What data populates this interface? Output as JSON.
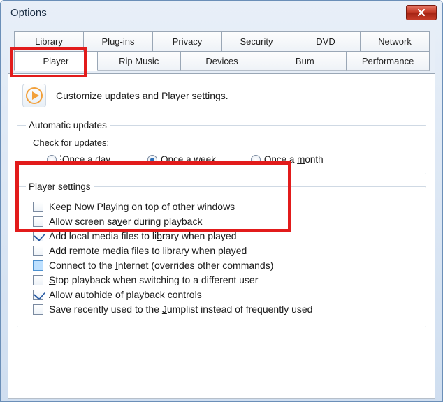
{
  "window": {
    "title": "Options"
  },
  "tabs": {
    "row1": [
      {
        "label": "Library",
        "name": "tab-library"
      },
      {
        "label": "Plug-ins",
        "name": "tab-plugins"
      },
      {
        "label": "Privacy",
        "name": "tab-privacy"
      },
      {
        "label": "Security",
        "name": "tab-security"
      },
      {
        "label": "DVD",
        "name": "tab-dvd"
      },
      {
        "label": "Network",
        "name": "tab-network"
      }
    ],
    "row2": [
      {
        "label": "Player",
        "name": "tab-player",
        "active": true
      },
      {
        "label": "Rip Music",
        "name": "tab-rip-music"
      },
      {
        "label": "Devices",
        "name": "tab-devices"
      },
      {
        "label": "Bum",
        "name": "tab-burn"
      },
      {
        "label": "Performance",
        "name": "tab-performance"
      }
    ]
  },
  "header": {
    "text": "Customize updates and Player settings."
  },
  "updates": {
    "legend": "Automatic updates",
    "check_label": "Check for updates:",
    "options": {
      "day": "Once a day",
      "week_pre": "Once a ",
      "week_u": "w",
      "week_post": "eek",
      "month_pre": "Once a ",
      "month_u": "m",
      "month_post": "onth"
    },
    "selected": "week"
  },
  "player_settings": {
    "legend": "Player settings",
    "items": [
      {
        "name": "keep-now-playing-on-top",
        "checked": false,
        "pre": "Keep Now Playing on ",
        "u": "t",
        "post": "op of other windows"
      },
      {
        "name": "allow-screen-saver",
        "checked": false,
        "pre": "Allow screen sa",
        "u": "v",
        "post": "er during playback"
      },
      {
        "name": "add-local-media",
        "checked": true,
        "pre": "Add local media files to li",
        "u": "b",
        "post": "rary when played"
      },
      {
        "name": "add-remote-media",
        "checked": false,
        "pre": "Add ",
        "u": "r",
        "post": "emote media files to library when played"
      },
      {
        "name": "connect-internet",
        "checked": false,
        "blue": true,
        "pre": "Connect to the ",
        "u": "I",
        "post": "nternet (overrides other commands)"
      },
      {
        "name": "stop-playback-switch-user",
        "checked": false,
        "pre": "",
        "u": "S",
        "post": "top playback when switching to a different user"
      },
      {
        "name": "allow-autohide",
        "checked": true,
        "pre": "Allow autoh",
        "u": "i",
        "post": "de of playback controls"
      },
      {
        "name": "save-jumplist",
        "checked": false,
        "pre": "Save recently used to the ",
        "u": "J",
        "post": "umplist instead of frequently used"
      }
    ]
  }
}
